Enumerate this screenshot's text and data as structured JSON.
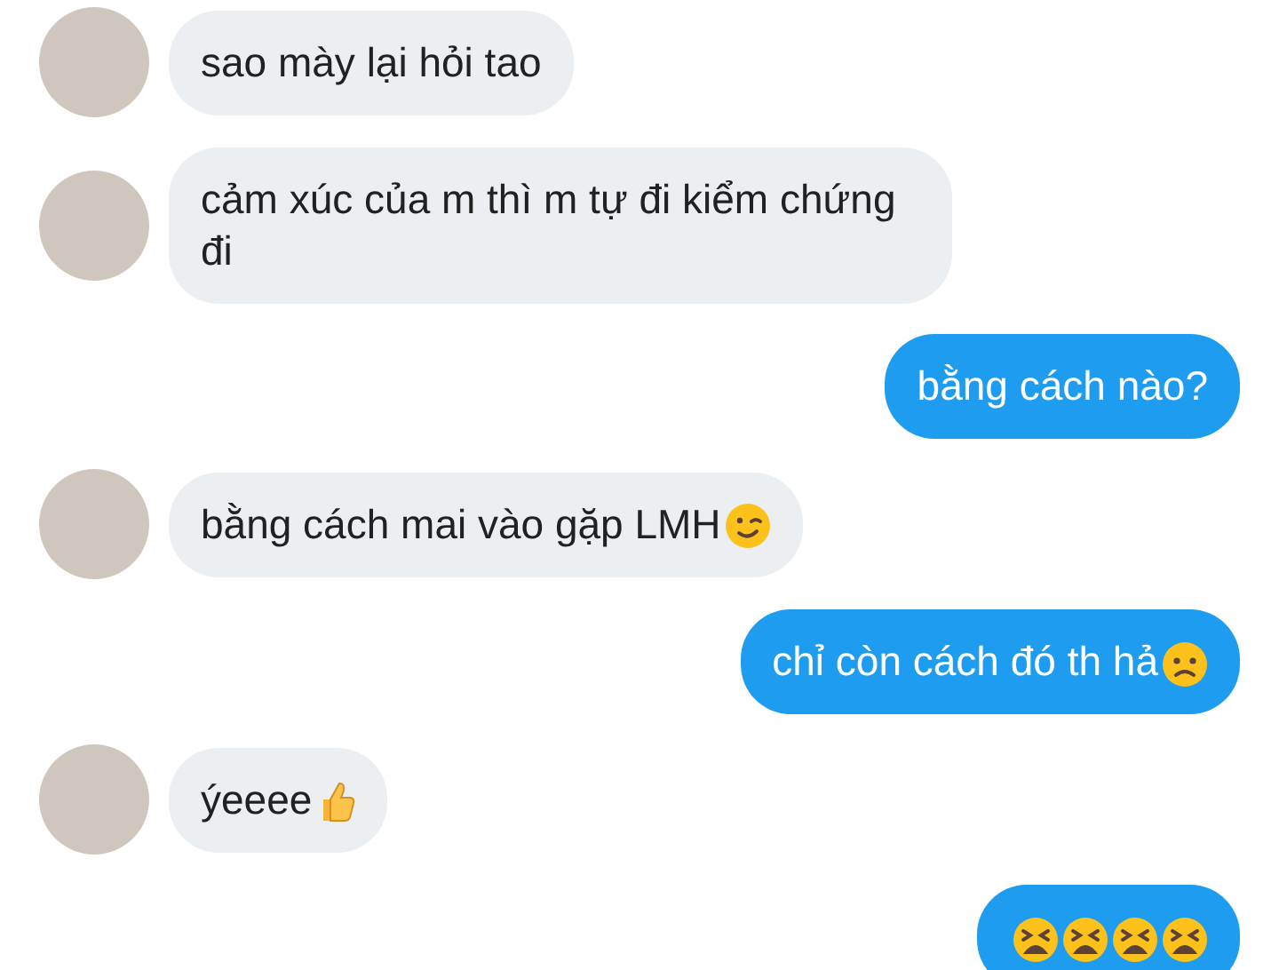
{
  "messages": [
    {
      "kind": "received",
      "text": "sao mày lại hỏi tao"
    },
    {
      "kind": "received",
      "text": "cảm xúc của m thì m tự đi kiểm chứng đi"
    },
    {
      "kind": "sent",
      "text": "bằng cách nào?"
    },
    {
      "kind": "received",
      "text": "bằng cách mai vào gặp LMH",
      "emoji": [
        {
          "kind": "wink"
        }
      ]
    },
    {
      "kind": "sent",
      "text": "chỉ còn cách đó th hả",
      "emoji": [
        {
          "kind": "worried"
        }
      ]
    },
    {
      "kind": "received",
      "text": "ýeeee",
      "emoji": [
        {
          "kind": "thumbs"
        }
      ]
    },
    {
      "kind": "sent",
      "emoji": [
        {
          "kind": "tired"
        },
        {
          "kind": "tired"
        },
        {
          "kind": "tired"
        },
        {
          "kind": "tired"
        }
      ]
    }
  ]
}
